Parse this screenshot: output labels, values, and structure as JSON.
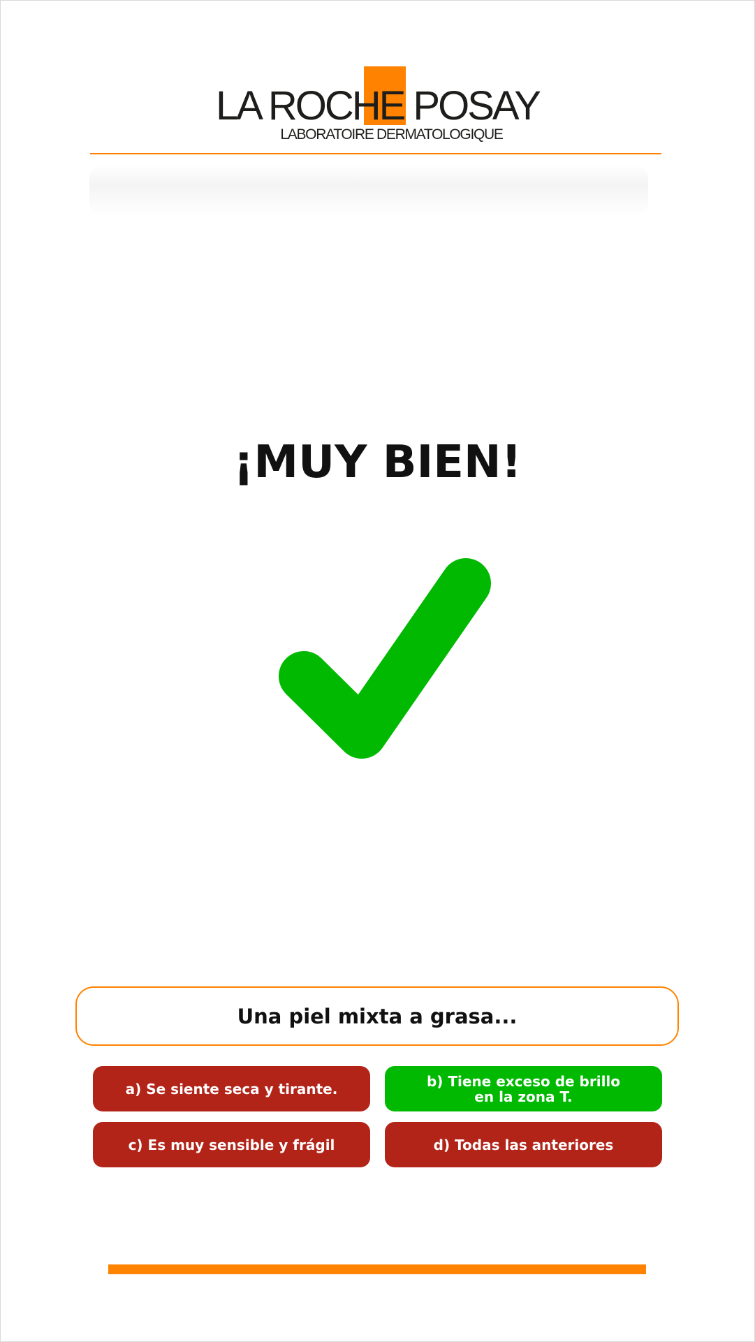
{
  "brand": {
    "name": "LA ROCHE POSAY",
    "tagline": "LABORATOIRE DERMATOLOGIQUE",
    "accent_color": "#ff8200"
  },
  "result": {
    "title": "¡MUY BIEN!",
    "icon": "checkmark-icon",
    "color": "#00b900"
  },
  "question": {
    "text": "Una piel mixta a grasa..."
  },
  "answers": [
    {
      "label": "a) Se siente seca y tirante.",
      "status": "wrong",
      "color": "#b22318"
    },
    {
      "label": "b) Tiene exceso de brillo\nen la zona T.",
      "status": "correct",
      "color": "#00b900"
    },
    {
      "label": "c) Es muy sensible y frágil",
      "status": "wrong",
      "color": "#b22318"
    },
    {
      "label": "d) Todas las anteriores",
      "status": "wrong",
      "color": "#b22318"
    }
  ]
}
